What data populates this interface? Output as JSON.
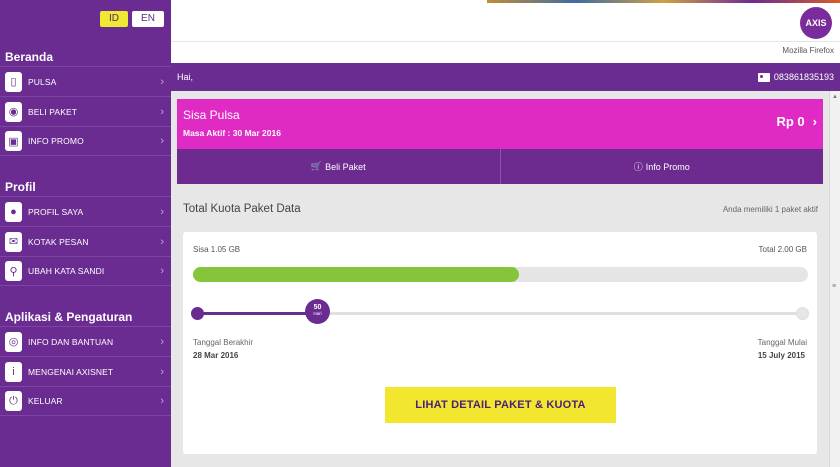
{
  "language": {
    "id": "ID",
    "en": "EN"
  },
  "sidebar": {
    "sections": [
      {
        "title": "Beranda",
        "items": [
          {
            "label": "PULSA",
            "icon": "phone-icon"
          },
          {
            "label": "BELI PAKET",
            "icon": "package-icon"
          },
          {
            "label": "INFO PROMO",
            "icon": "gift-icon"
          }
        ]
      },
      {
        "title": "Profil",
        "items": [
          {
            "label": "PROFIL SAYA",
            "icon": "user-icon"
          },
          {
            "label": "KOTAK PESAN",
            "icon": "mail-icon"
          },
          {
            "label": "UBAH KATA SANDI",
            "icon": "key-icon"
          }
        ]
      },
      {
        "title": "Aplikasi & Pengaturan",
        "items": [
          {
            "label": "INFO DAN BANTUAN",
            "icon": "help-icon"
          },
          {
            "label": "MENGENAI AXISNET",
            "icon": "info-icon"
          },
          {
            "label": "KELUAR",
            "icon": "power-icon"
          }
        ]
      }
    ]
  },
  "header": {
    "logo": "AXIS",
    "browser": "Mozilla Firefox"
  },
  "greeting": {
    "text": "Hai,",
    "phone": "083861835193"
  },
  "pulsa": {
    "title": "Sisa Pulsa",
    "active": "Masa Aktif : 30 Mar 2016",
    "balance": "Rp 0"
  },
  "tabs": {
    "beli": "Beli Paket",
    "promo": "Info Promo"
  },
  "kuota": {
    "title": "Total Kuota Paket Data",
    "subtitle": "Anda memiliki 1 paket aktif",
    "sisa": "Sisa 1.05 GB",
    "total": "Total 2.00 GB",
    "usage_fraction": 0.53,
    "days_left": "50",
    "days_unit": "Hari",
    "timeline_fraction": 0.2,
    "end_label": "Tanggal Berakhir",
    "end_date": "28 Mar 2016",
    "start_label": "Tanggal Mulai",
    "start_date": "15 July 2015",
    "cta": "LIHAT DETAIL PAKET & KUOTA"
  },
  "colors": {
    "primary": "#6b2c91",
    "accent": "#e02ac4",
    "highlight": "#f3e62f",
    "progress": "#86c53b"
  }
}
